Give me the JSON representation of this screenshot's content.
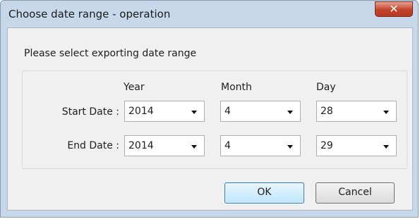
{
  "window": {
    "title": "Choose date range - operation",
    "close_glyph": "✕",
    "close_icon": "close-icon"
  },
  "prompt": "Please select exporting date range",
  "columns": {
    "year": "Year",
    "month": "Month",
    "day": "Day"
  },
  "start": {
    "label": "Start Date :",
    "year": "2014",
    "month": "4",
    "day": "28"
  },
  "end": {
    "label": "End Date :",
    "year": "2014",
    "month": "4",
    "day": "29"
  },
  "buttons": {
    "ok": "OK",
    "cancel": "Cancel"
  },
  "colors": {
    "frame": "#c6d8ea",
    "close_button": "#c0432b",
    "ok_border": "#3c7fb1"
  }
}
